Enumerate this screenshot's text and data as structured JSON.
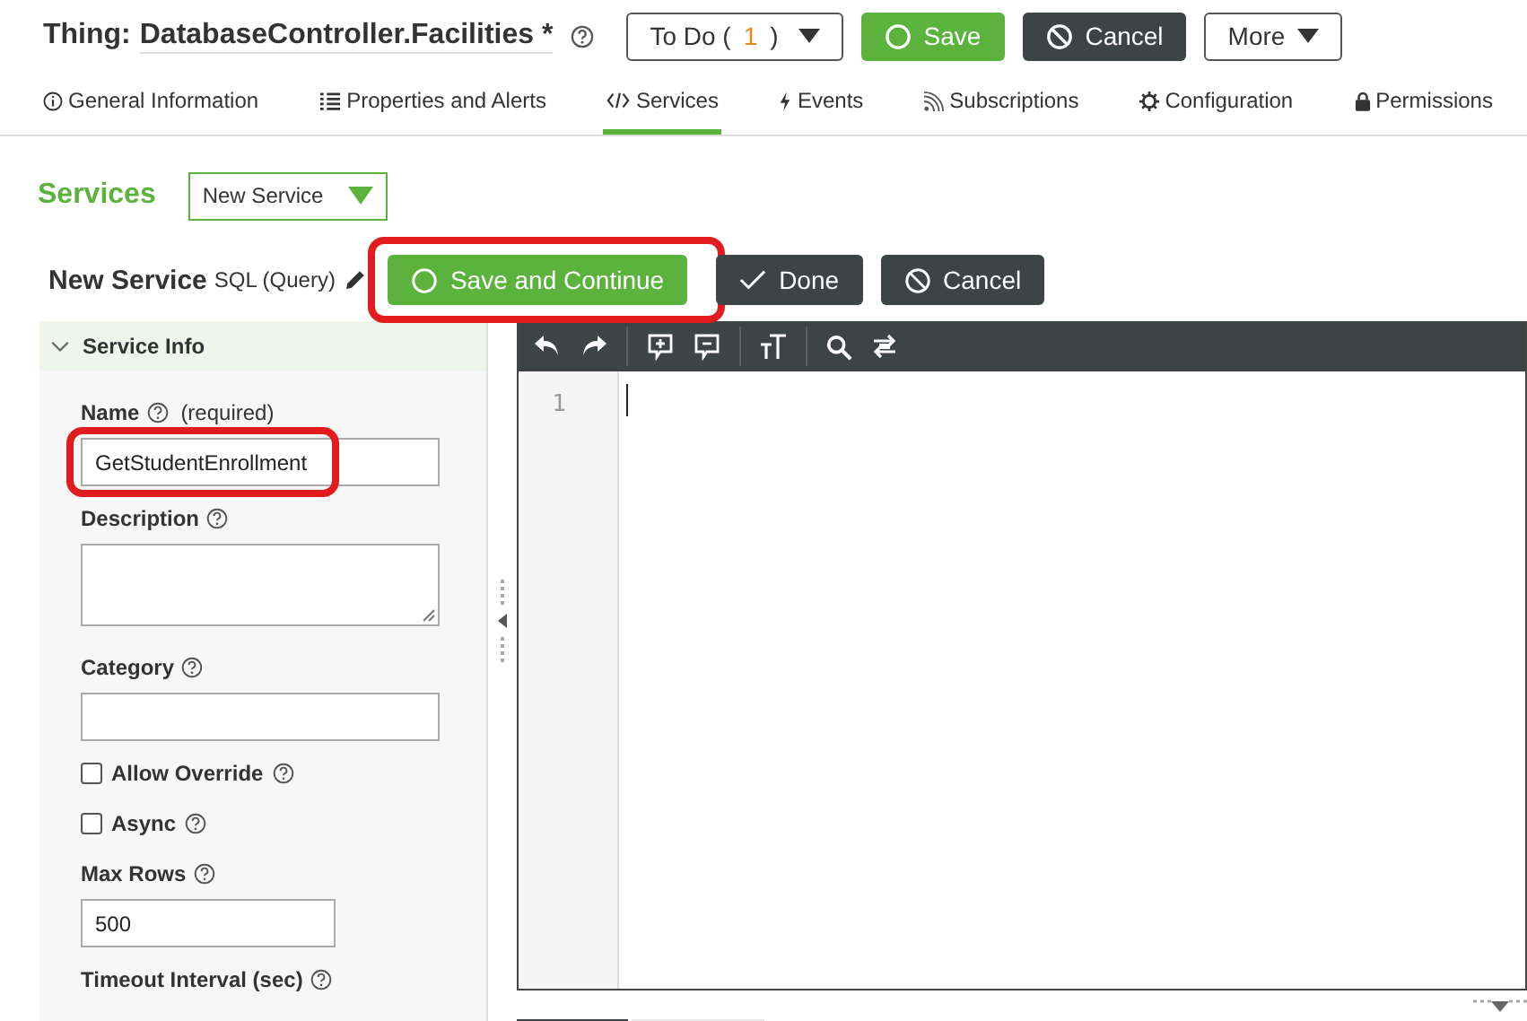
{
  "header": {
    "title_label": "Thing:",
    "title": "DatabaseController.Facilities *",
    "todo": {
      "label": "To Do (",
      "count": "1",
      "close": ")"
    },
    "buttons": [
      {
        "kind": "save",
        "label": "Save"
      },
      {
        "kind": "cancel",
        "label": "Cancel"
      },
      {
        "kind": "more",
        "label": "More"
      }
    ]
  },
  "tabs": [
    {
      "label": "General Information",
      "selected": false
    },
    {
      "label": "Properties and Alerts",
      "selected": false
    },
    {
      "label": "Services",
      "selected": true
    },
    {
      "label": "Events",
      "selected": false
    },
    {
      "label": "Subscriptions",
      "selected": false
    },
    {
      "label": "Configuration",
      "selected": false
    },
    {
      "label": "Permissions",
      "selected": false
    }
  ],
  "services": {
    "heading": "Services",
    "dropdown": "New Service"
  },
  "service_bar": {
    "title": "New Service",
    "type": "SQL (Query)",
    "buttons": [
      {
        "kind": "save",
        "label": "Save and Continue",
        "highlighted": true
      },
      {
        "kind": "done",
        "label": "Done",
        "highlighted": false
      },
      {
        "kind": "cancel",
        "label": "Cancel",
        "highlighted": false
      }
    ]
  },
  "service_info": {
    "heading": "Service Info",
    "expanded": true,
    "fields": [
      {
        "kind": "text",
        "label": "Name",
        "note": "(required)",
        "value": "GetStudentEnrollment",
        "highlighted": true
      },
      {
        "kind": "textarea",
        "label": "Description"
      },
      {
        "kind": "text",
        "label": "Category",
        "highlighted": false
      },
      {
        "kind": "checkbox",
        "label": "Allow Override",
        "checked": false
      },
      {
        "kind": "checkbox",
        "label": "Async",
        "checked": false
      },
      {
        "kind": "number",
        "label": "Max Rows",
        "value": "500"
      },
      {
        "kind": "heading",
        "label": "Timeout Interval (sec)"
      }
    ]
  },
  "editor": {
    "line_numbers": [
      "1"
    ]
  }
}
